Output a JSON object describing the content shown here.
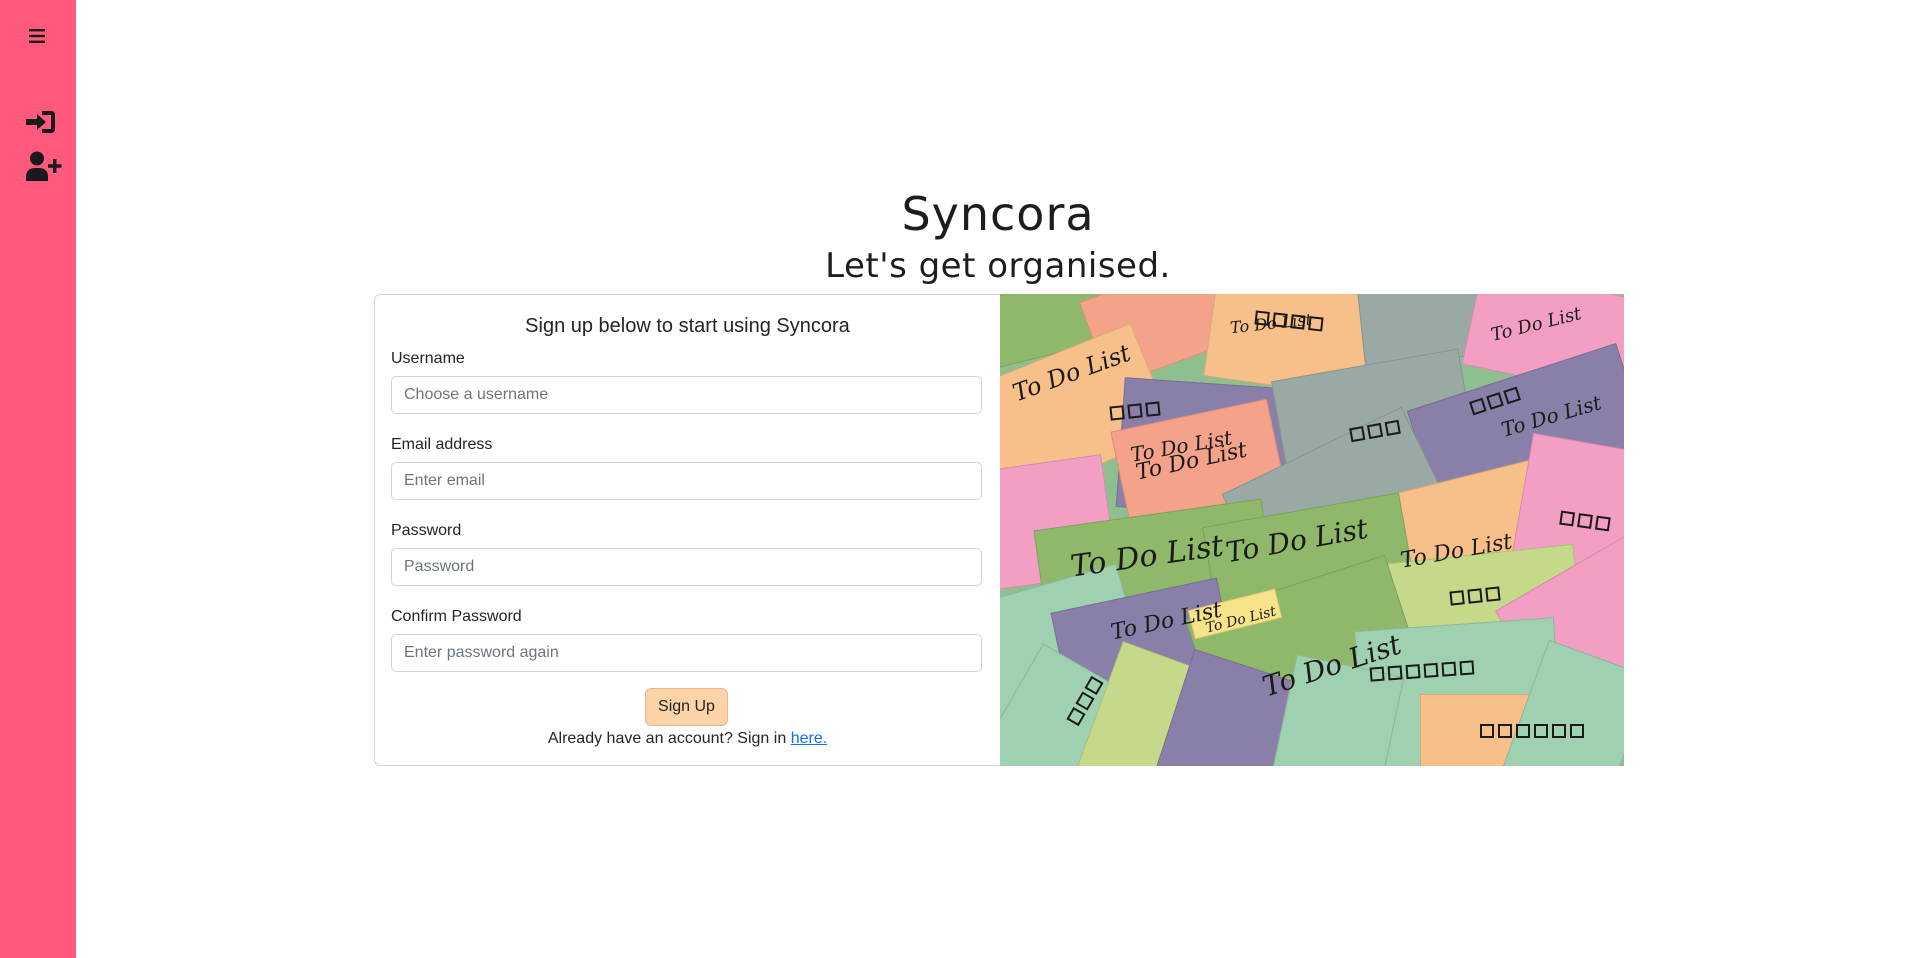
{
  "sidebar": {
    "menu_icon": "bars-icon",
    "signin_icon": "sign-in-icon",
    "signup_icon": "user-plus-icon",
    "background": "#ff5a7e"
  },
  "header": {
    "title": "Syncora",
    "subtitle": "Let's get organised."
  },
  "form": {
    "title": "Sign up below to start using Syncora",
    "username_label": "Username",
    "username_placeholder": "Choose a username",
    "email_label": "Email address",
    "email_placeholder": "Enter email",
    "password_label": "Password",
    "password_placeholder": "Password",
    "confirm_label": "Confirm Password",
    "confirm_placeholder": "Enter password again",
    "submit_label": "Sign Up",
    "signin_prompt": "Already have an account? Sign in",
    "signin_link": "here.",
    "button_color": "#fbd3a6"
  },
  "hero": {
    "note_text": "To Do List",
    "note_colors": [
      "#8fb86a",
      "#f4a38a",
      "#f7c08a",
      "#8a7fa8",
      "#9aa9a4",
      "#f29fc3",
      "#9fd1b0",
      "#f8e38a",
      "#c6d88a"
    ]
  }
}
